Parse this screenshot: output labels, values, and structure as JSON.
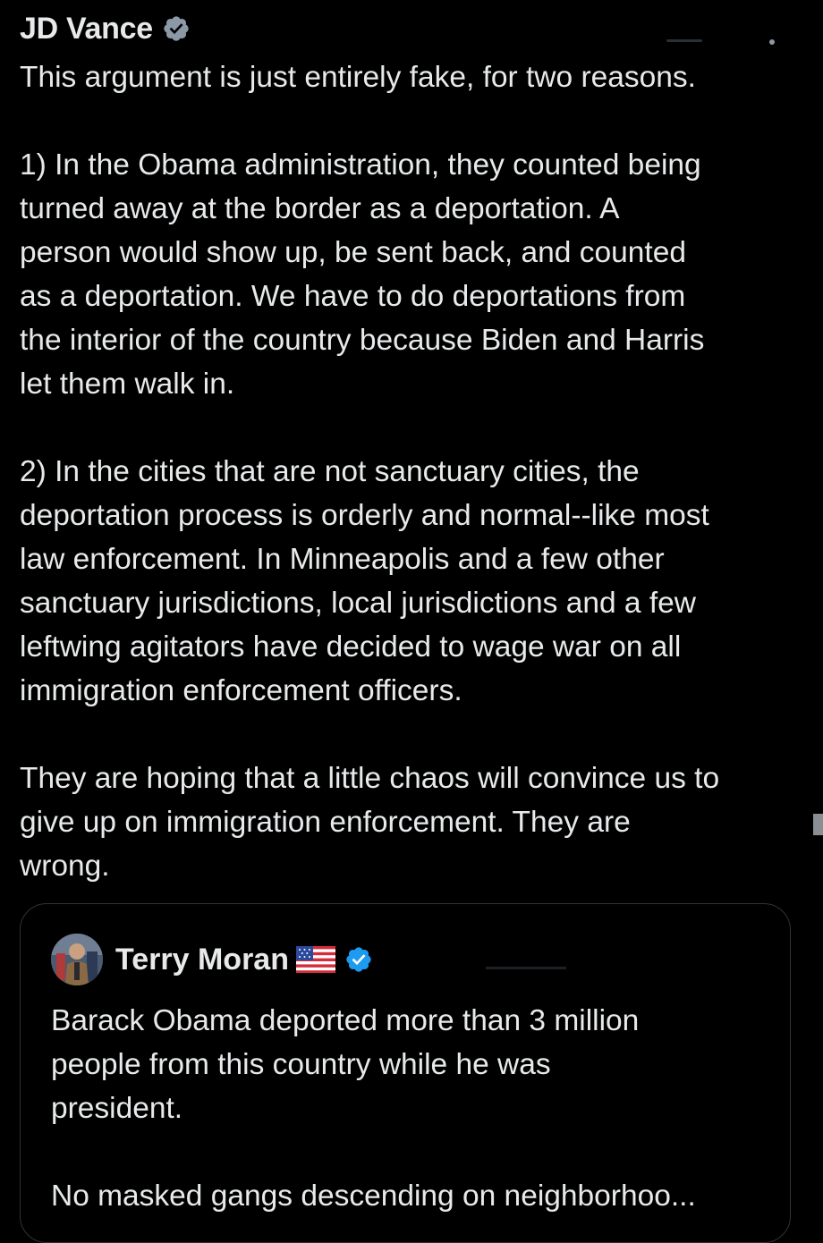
{
  "post": {
    "author": "JD Vance",
    "verified_icon": "verified-badge-icon",
    "paragraphs": [
      "This argument is just entirely fake, for two reasons.",
      "1) In the Obama administration, they counted being\nturned away at the border as a deportation. A\nperson would show up, be sent back, and counted\nas a deportation. We have to do deportations from\nthe interior of the country because Biden and Harris\nlet them walk in.",
      "2) In the cities that are not sanctuary cities, the\ndeportation process is orderly and normal--like most\nlaw enforcement. In Minneapolis and a few other\nsanctuary jurisdictions, local jurisdictions and a few\nleftwing agitators have decided to wage war on all\nimmigration enforcement officers.",
      "They are hoping that a little chaos will convince us to\ngive up on immigration enforcement. They are\nwrong."
    ]
  },
  "quote": {
    "author": "Terry Moran",
    "flag_icon": "us-flag-icon",
    "verified_icon": "verified-badge-icon",
    "paragraphs": [
      "Barack Obama deported more than 3 million\npeople from this country while he was\npresident.",
      "No masked gangs descending on neighborhoo..."
    ]
  },
  "colors": {
    "background": "#000000",
    "text": "#e7e9ea",
    "verified_gold": "#8b98a5",
    "verified_blue": "#1d9bf0",
    "card_border": "#2f3336"
  }
}
